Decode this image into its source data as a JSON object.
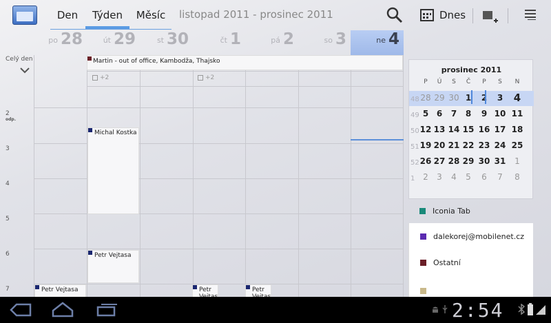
{
  "header": {
    "tabs": [
      {
        "label": "Den"
      },
      {
        "label": "Týden"
      },
      {
        "label": "Měsíc"
      }
    ],
    "date_range": "listopad 2011 - prosinec 2011",
    "today_label": "Dnes"
  },
  "week": {
    "days": [
      {
        "name": "po",
        "num": "28"
      },
      {
        "name": "út",
        "num": "29"
      },
      {
        "name": "st",
        "num": "30"
      },
      {
        "name": "čt",
        "num": "1"
      },
      {
        "name": "pá",
        "num": "2"
      },
      {
        "name": "so",
        "num": "3"
      },
      {
        "name": "ne",
        "num": "4"
      }
    ]
  },
  "allday": {
    "label": "Celý den",
    "event": "Martin - out of office, Kambodža, Thajsko",
    "more": [
      "+2",
      "+2"
    ]
  },
  "hours": [
    {
      "h": "2",
      "s": "odp."
    },
    {
      "h": "3",
      "s": ""
    },
    {
      "h": "4",
      "s": ""
    },
    {
      "h": "5",
      "s": ""
    },
    {
      "h": "6",
      "s": ""
    },
    {
      "h": "7",
      "s": ""
    }
  ],
  "events": [
    {
      "title": "Michal Kostka"
    },
    {
      "title": "Petr Vejtasa"
    },
    {
      "title": "Petr Vejtasa"
    },
    {
      "title": "Petr Vejtas"
    },
    {
      "title": "Petr Vejtas"
    }
  ],
  "mini": {
    "title": "prosinec 2011",
    "weekdays": [
      "P",
      "Ú",
      "S",
      "Č",
      "P",
      "S",
      "N"
    ],
    "rows": [
      {
        "wk": "48",
        "days": [
          "28",
          "29",
          "30",
          "1",
          "2",
          "3",
          "4"
        ]
      },
      {
        "wk": "49",
        "days": [
          "5",
          "6",
          "7",
          "8",
          "9",
          "10",
          "11"
        ]
      },
      {
        "wk": "50",
        "days": [
          "12",
          "13",
          "14",
          "15",
          "16",
          "17",
          "18"
        ]
      },
      {
        "wk": "51",
        "days": [
          "19",
          "20",
          "21",
          "22",
          "23",
          "24",
          "25"
        ]
      },
      {
        "wk": "52",
        "days": [
          "26",
          "27",
          "28",
          "29",
          "30",
          "31",
          "1"
        ]
      },
      {
        "wk": "1",
        "days": [
          "2",
          "3",
          "4",
          "5",
          "6",
          "7",
          "8"
        ]
      }
    ]
  },
  "calendars": [
    {
      "name": "Iconia Tab",
      "color": "#1a8a7a"
    },
    {
      "name": "dalekorej@mobilenet.cz",
      "color": "#5b2bb0"
    },
    {
      "name": "Ostatní",
      "color": "#6a1f28"
    },
    {
      "name": "",
      "color": "#c9b98a"
    }
  ],
  "status": {
    "time": "2:54"
  }
}
